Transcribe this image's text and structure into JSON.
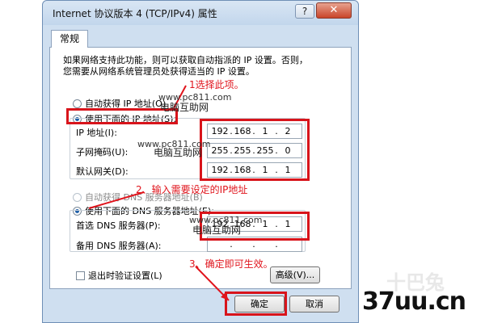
{
  "window": {
    "title": "Internet 协议版本 4 (TCP/IPv4) 属性",
    "help_glyph": "?",
    "close_glyph": "✕"
  },
  "tab": {
    "label": "常规"
  },
  "intro": {
    "line1": "如果网络支持此功能，则可以获取自动指派的 IP 设置。否则，",
    "line2": "您需要从网络系统管理员处获得适当的 IP 设置。"
  },
  "ip_section": {
    "auto_label": "自动获得 IP 地址(O)",
    "manual_label": "使用下面的 IP 地址(S):",
    "selected": "manual",
    "fields": [
      {
        "label": "IP 地址(I):",
        "value": [
          "192",
          "168",
          "1",
          "2"
        ]
      },
      {
        "label": "子网掩码(U):",
        "value": [
          "255",
          "255",
          "255",
          "0"
        ]
      },
      {
        "label": "默认网关(D):",
        "value": [
          "192",
          "168",
          "1",
          "1"
        ]
      }
    ]
  },
  "dns_section": {
    "auto_label": "自动获得 DNS 服务器地址(B)",
    "manual_label": "使用下面的 DNS 服务器地址(E):",
    "selected": "manual",
    "fields": [
      {
        "label": "首选 DNS 服务器(P):",
        "value": [
          "192",
          "168",
          "1",
          "1"
        ]
      },
      {
        "label": "备用 DNS 服务器(A):",
        "value": [
          "",
          "",
          "",
          ""
        ]
      }
    ]
  },
  "validate_checkbox": {
    "label": "退出时验证设置(L)",
    "checked": false
  },
  "buttons": {
    "advanced": "高级(V)...",
    "ok": "确定",
    "cancel": "取消"
  },
  "annotations": {
    "step1": "1选择此项。",
    "step2": "2、输入需要设定的IP地址",
    "step3": "3、确定即可生效。"
  },
  "watermarks": {
    "site": "www.pc811.com",
    "site_short": "www.pc811.com",
    "site_dns": "www.pc811.com",
    "name": "电脑互助网"
  },
  "corner_brand": {
    "text": "37uu.cn",
    "faint": "十巴兔"
  },
  "colors": {
    "annotation_red": "#d8141b",
    "dialog_bg": "#cfdff0"
  }
}
